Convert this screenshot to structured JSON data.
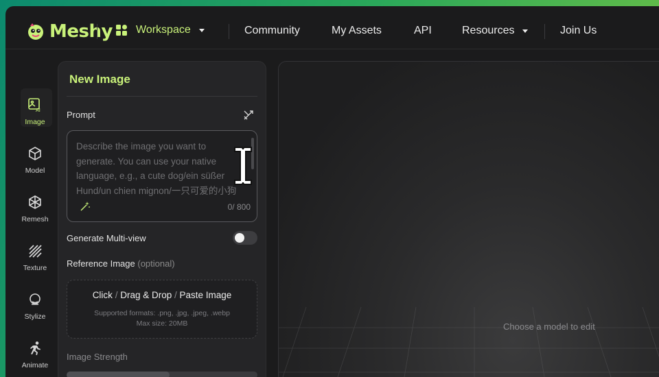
{
  "brand": {
    "name": "Meshy"
  },
  "nav": {
    "workspace": "Workspace",
    "community": "Community",
    "my_assets": "My Assets",
    "api": "API",
    "resources": "Resources",
    "join_us": "Join Us"
  },
  "rail": [
    {
      "label": "Image",
      "icon": "image-ai-icon",
      "active": true
    },
    {
      "label": "Model",
      "icon": "cube-icon"
    },
    {
      "label": "Remesh",
      "icon": "remesh-icon"
    },
    {
      "label": "Texture",
      "icon": "texture-icon"
    },
    {
      "label": "Stylize",
      "icon": "stylize-icon"
    },
    {
      "label": "Animate",
      "icon": "run-icon"
    }
  ],
  "panel": {
    "title": "New Image",
    "prompt_label": "Prompt",
    "prompt_placeholder": "Describe the image you want to generate. You can use your native language, e.g., a cute dog/ein süßer Hund/un chien mignon/一只可爱的小狗",
    "counter": "0/ 800",
    "multiview_label": "Generate Multi-view",
    "multiview_on": false,
    "reference_label": "Reference Image",
    "reference_optional": "(optional)",
    "drop_click": "Click",
    "drop_sep1": " / ",
    "drop_drag": "Drag & Drop",
    "drop_sep2": " / ",
    "drop_paste": "Paste Image",
    "drop_formats": "Supported formats: .png, .jpg, .jpeg, .webp",
    "drop_size": "Max size: 20MB",
    "strength_label": "Image Strength"
  },
  "canvas": {
    "message": "Choose a model to edit"
  },
  "colors": {
    "accent": "#c9f27a",
    "bg": "#1b1b1c",
    "panel": "#252527"
  }
}
